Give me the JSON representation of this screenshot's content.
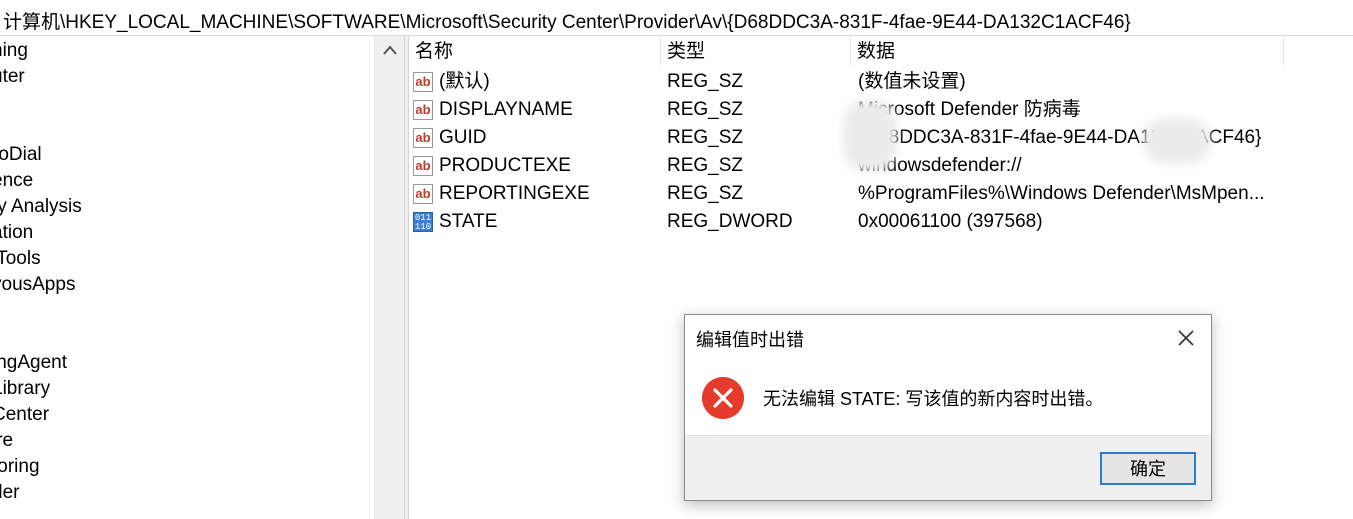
{
  "address": {
    "path": "计算机\\HKEY_LOCAL_MACHINE\\SOFTWARE\\Microsoft\\Security Center\\Provider\\Av\\{D68DDC3A-831F-4fae-9E44-DA132C1ACF46}"
  },
  "tree": {
    "items": [
      "ning",
      "uter",
      "",
      "",
      "roDial",
      "ence",
      "ty Analysis",
      "ation",
      "lTools",
      "yousApps",
      "",
      "",
      "ingAgent",
      " Library",
      " Center",
      "ire",
      "toring",
      "der"
    ]
  },
  "values": {
    "headers": {
      "name": "名称",
      "type": "类型",
      "data": "数据"
    },
    "rows": [
      {
        "icon": "string-value-icon",
        "name": "(默认)",
        "type": "REG_SZ",
        "data": "(数值未设置)"
      },
      {
        "icon": "string-value-icon",
        "name": "DISPLAYNAME",
        "type": "REG_SZ",
        "data": "Microsoft Defender 防病毒"
      },
      {
        "icon": "string-value-icon",
        "name": "GUID",
        "type": "REG_SZ",
        "data": "{D68DDC3A-831F-4fae-9E44-DA132C1ACF46}"
      },
      {
        "icon": "string-value-icon",
        "name": "PRODUCTEXE",
        "type": "REG_SZ",
        "data": "windowsdefender://"
      },
      {
        "icon": "string-value-icon",
        "name": "REPORTINGEXE",
        "type": "REG_SZ",
        "data": "%ProgramFiles%\\Windows Defender\\MsMpen..."
      },
      {
        "icon": "dword-value-icon",
        "name": "STATE",
        "type": "REG_DWORD",
        "data": "0x00061100 (397568)"
      }
    ]
  },
  "dialog": {
    "title": "编辑值时出错",
    "message": "无法编辑 STATE: 写该值的新内容时出错。",
    "ok_label": "确定",
    "close_glyph": "✕",
    "error_glyph": "✕"
  },
  "icons": {
    "ab_text": "ab",
    "bin_text": "011\n110",
    "scroll_up": "▲"
  }
}
